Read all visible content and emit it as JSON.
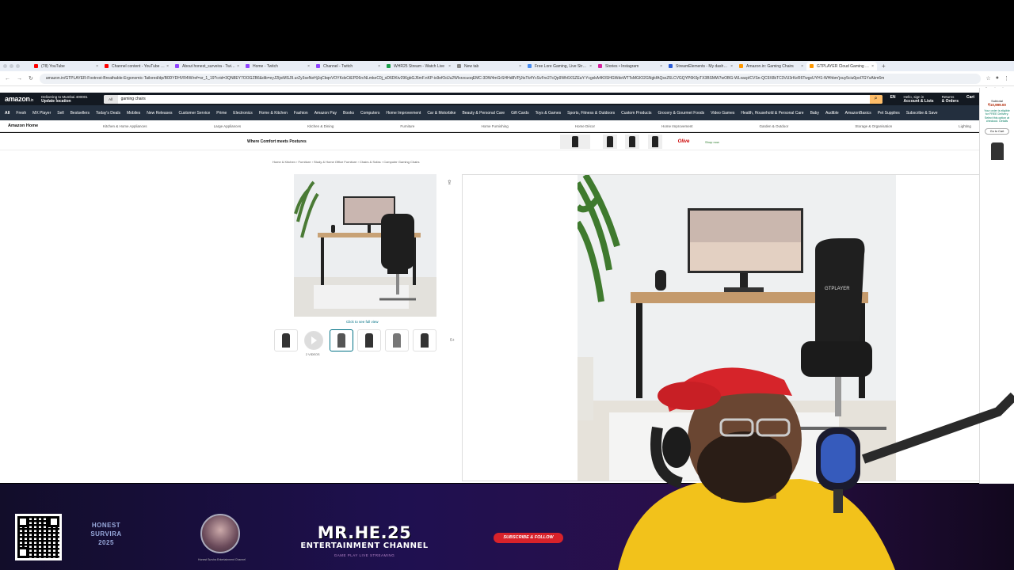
{
  "browser": {
    "tabs": [
      {
        "label": "(78) YouTube",
        "color": "#ff0000",
        "active": false
      },
      {
        "label": "Channel content - YouTube Studio",
        "color": "#ff0000",
        "active": false
      },
      {
        "label": "About honest_surveira - Twitch",
        "color": "#9146ff",
        "active": false
      },
      {
        "label": "Home - Twitch",
        "color": "#9146ff",
        "active": false
      },
      {
        "label": "Channel - Twitch",
        "color": "#9146ff",
        "active": false
      },
      {
        "label": "WHR25 Stream - Watch Live",
        "color": "#1a9e4a",
        "active": false
      },
      {
        "label": "New tab",
        "color": "#8a8a8a",
        "active": false
      },
      {
        "label": "Free Lore Gaming, Live Stream",
        "color": "#4a8df0",
        "active": false
      },
      {
        "label": "Stories • Instagram",
        "color": "#d6249f",
        "active": false
      },
      {
        "label": "StreamElements - My dashboard",
        "color": "#2b5cd6",
        "active": false
      },
      {
        "label": "Amazon.in: Gaming Chairs",
        "color": "#ff9900",
        "active": false
      },
      {
        "label": "GTPLAYER Cloud Gaming C...",
        "color": "#ff9900",
        "active": true
      }
    ],
    "new_tab": "+",
    "url": "amazon.in/GTPLAYER-Footrest-Breathable-Ergonomic-Tailored/dp/B0DYDHVR4W/ref=sr_1_19?crid=3QN8EY7OOGZB6&dib=eyJ2IjoiMSJ9.urZy3seNeHjJqCbqnVOYKdxCtEPD6rcNLmkeC0j_oD6DKtv296gbGJ6mF.nKP-is9efOdJu2WIxrzcuoqEMC-3DW4mGrSHHd8VPjJtsTk4YcSvFre27cQp9Wh6XSZEaY-YcgxkA4K0SHGWdeWTTsMGIO2GNgkfAQsxZ6LCVGQYP6K0pTX3BSMW7wOBG-WLxacpICVSn-QC9X8kTC3VU3rKeR6TwgxUYH1-WHhbm'jouy5ciu0pol7GYsAkm6m",
    "all_bookmarks": "All Bookmarks"
  },
  "amazon": {
    "logo": "amazon",
    "logo_suffix": ".in",
    "location_line1": "Delivering to Mumbai 400001",
    "location_line2": "Update location",
    "search_category": "All",
    "search_query": "gaming chairs",
    "lang": "EN",
    "account_line1": "Hello, sign in",
    "account_line2": "Account & Lists",
    "returns_line1": "Returns",
    "returns_line2": "& Orders",
    "cart": "Cart",
    "nav": [
      "All",
      "Fresh",
      "MX Player",
      "Sell",
      "Bestsellers",
      "Today's Deals",
      "Mobiles",
      "New Releases",
      "Customer Service",
      "Prime",
      "Electronics",
      "Home & Kitchen",
      "Fashion",
      "Amazon Pay",
      "Books",
      "Computers",
      "Home Improvement",
      "Car & Motorbike",
      "Beauty & Personal Care",
      "Gift Cards",
      "Toys & Games",
      "Sports, Fitness & Outdoors",
      "Custom Products",
      "Grocery & Gourmet Foods",
      "Video Games",
      "Health, Household & Personal Care",
      "Baby",
      "Audible",
      "AmazonBasics",
      "Pet Supplies",
      "Subscribe & Save"
    ],
    "store_name": "Amazon Home",
    "sub_nav": [
      "Kitchen & Home Appliances",
      "Large Appliances",
      "Kitchen & Dining",
      "Furniture",
      "Home Furnishing",
      "Home Décor",
      "Home Improvement",
      "Garden & Outdoor",
      "Storage & Organisation",
      "Lighting"
    ],
    "banner_tagline": "Where Comfort meets Postures",
    "banner_brand": "Olive",
    "banner_cta": "Shop now",
    "sponsored": "Sponsored",
    "breadcrumb": "Home & Kitchen › Furniture › Study & Home Office Furniture › Chairs & Sofas › Computer Gaming Chairs",
    "click_full_view": "Click to see full view",
    "video_count": "2 VIDEOS",
    "more_thumbs": "6+",
    "share_icon": "share-icon",
    "right_subtotal": "Subtotal",
    "right_price": "₹10,999.00",
    "right_msg": "Your order is eligible for FREE Delivery. Select this option at checkout. Details",
    "go_to_cart": "Go to Cart"
  },
  "overlay": {
    "year_text_1": "HONEST SURVIRA",
    "year_text_2": "2025",
    "avatar_caption": "Honest Survira Entertainment Channel",
    "brand": "MR.HE.25",
    "brand_sub": "ENTERTAINMENT CHANNEL",
    "brand_tag": "GAME PLAY LIVE STREAMING",
    "subscribe": "SUBSCRIBE & FOLLOW"
  },
  "colors": {
    "amazon_dark": "#131921",
    "amazon_nav": "#232f3e",
    "amazon_orange": "#febd69",
    "subscribe_red": "#d8222a"
  }
}
